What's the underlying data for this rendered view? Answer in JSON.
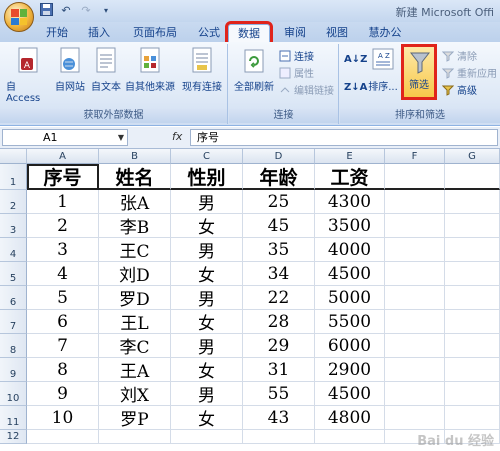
{
  "title": "新建 Microsoft Offi",
  "qat": [
    "save-icon",
    "undo-icon",
    "redo-icon",
    "customize-icon"
  ],
  "tabs": [
    "开始",
    "插入",
    "页面布局",
    "公式",
    "数据",
    "审阅",
    "视图",
    "慧办公"
  ],
  "active_tab": "数据",
  "ribbon": {
    "get_external": {
      "label": "获取外部数据",
      "buttons": [
        "自 Access",
        "自网站",
        "自文本",
        "自其他来源",
        "现有连接"
      ]
    },
    "connections": {
      "label": "连接",
      "refresh": "全部刷新",
      "small": [
        "连接",
        "属性",
        "编辑链接"
      ]
    },
    "sort_filter": {
      "label": "排序和筛选",
      "sort": "排序...",
      "filter": "筛选",
      "small": [
        "清除",
        "重新应用",
        "高级"
      ]
    }
  },
  "formula_bar": {
    "name_box": "A1",
    "fx": "fx",
    "content": "序号"
  },
  "columns": [
    "A",
    "B",
    "C",
    "D",
    "E",
    "F",
    "G"
  ],
  "rows": [
    "1",
    "2",
    "3",
    "4",
    "5",
    "6",
    "7",
    "8",
    "9",
    "10",
    "11",
    "12"
  ],
  "table": {
    "headers": [
      "序号",
      "姓名",
      "性别",
      "年龄",
      "工资"
    ],
    "data": [
      [
        "1",
        "张A",
        "男",
        "25",
        "4300"
      ],
      [
        "2",
        "李B",
        "女",
        "45",
        "3500"
      ],
      [
        "3",
        "王C",
        "男",
        "35",
        "4000"
      ],
      [
        "4",
        "刘D",
        "女",
        "34",
        "4500"
      ],
      [
        "5",
        "罗D",
        "男",
        "22",
        "5000"
      ],
      [
        "6",
        "王L",
        "女",
        "28",
        "5500"
      ],
      [
        "7",
        "李C",
        "男",
        "29",
        "6000"
      ],
      [
        "8",
        "王A",
        "女",
        "31",
        "2900"
      ],
      [
        "9",
        "刘X",
        "男",
        "55",
        "4500"
      ],
      [
        "10",
        "罗P",
        "女",
        "43",
        "4800"
      ]
    ]
  },
  "watermark": "Bai du 经验",
  "colors": {
    "highlight": "#e0241b",
    "ribbon_bg": "#dde8f6"
  }
}
